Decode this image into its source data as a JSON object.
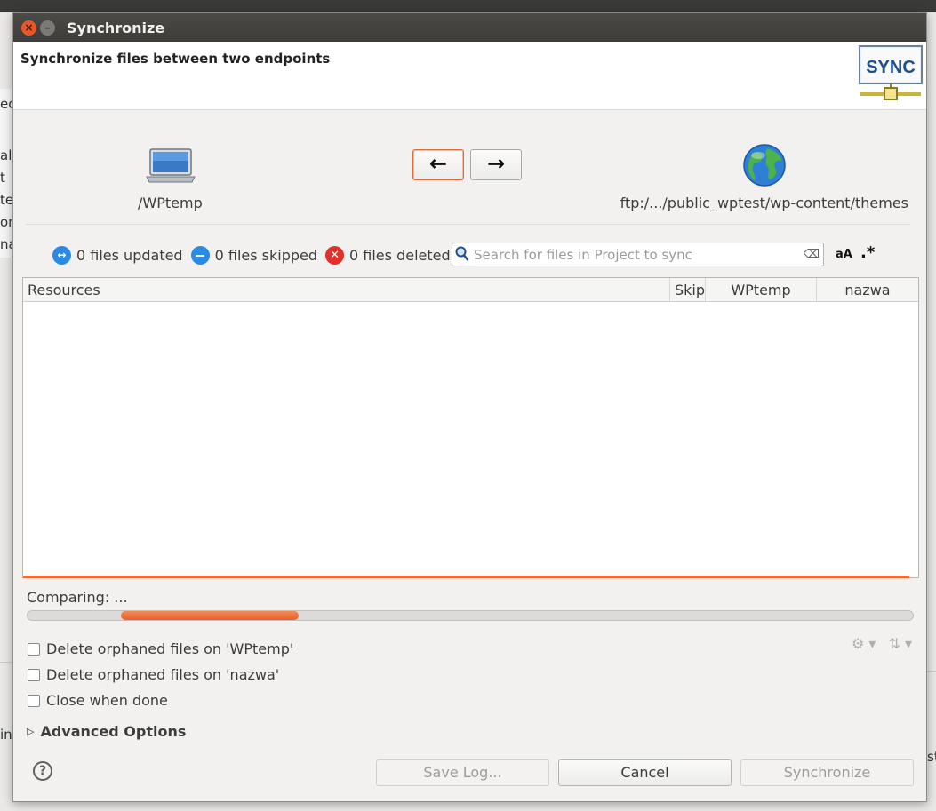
{
  "window": {
    "title": "Synchronize"
  },
  "header": {
    "title": "Synchronize files between two endpoints",
    "logo_text": "SYNC"
  },
  "endpoints": {
    "left": {
      "label": "/WPtemp",
      "icon": "laptop-icon"
    },
    "right": {
      "label": "ftp:/.../public_wptest/wp-content/themes",
      "icon": "globe-icon"
    }
  },
  "direction": {
    "left_symbol": "←",
    "right_symbol": "→",
    "selected": "left"
  },
  "stats": {
    "updated": "0 files updated",
    "skipped": "0 files skipped",
    "deleted": "0 files deleted"
  },
  "search": {
    "placeholder": "Search for files in Project to sync",
    "value": "",
    "case_label": "aA",
    "regex_label": ".*"
  },
  "table": {
    "columns": [
      "Resources",
      "Skip",
      "WPtemp",
      "nazwa"
    ],
    "rows": []
  },
  "progress": {
    "label": "Comparing: ...",
    "indeterminate": true
  },
  "options": {
    "delete_orphaned_left": "Delete orphaned files on 'WPtemp'",
    "delete_orphaned_right": "Delete orphaned files on 'nazwa'",
    "close_when_done": "Close when done"
  },
  "advanced": {
    "label": "Advanced Options"
  },
  "buttons": {
    "save_log": "Save Log...",
    "cancel": "Cancel",
    "synchronize": "Synchronize"
  },
  "colors": {
    "accent": "#ef6c36",
    "info": "#2a8ae6",
    "danger": "#e0322b"
  },
  "background_fragments": [
    "ec",
    "al",
    "t",
    "te",
    "on",
    "na",
    "in",
    "st"
  ]
}
